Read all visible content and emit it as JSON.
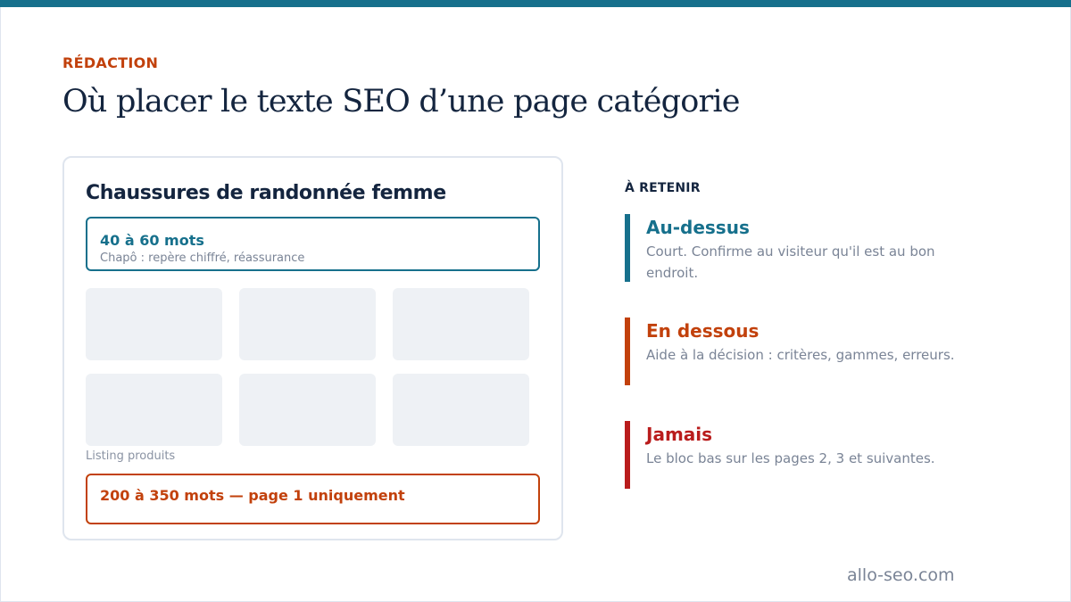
{
  "colors": {
    "accent_teal": "#16708c",
    "accent_orange": "#c2410c",
    "accent_red": "#b91c1c",
    "ink": "#14253f"
  },
  "kicker": "RÉDACTION",
  "title": "Où placer le texte SEO d’une page catégorie",
  "mockup": {
    "page_title": "Chaussures de randonnée femme",
    "top_block": {
      "label": "40 à 60 mots",
      "description": "Chapô : repère chiffré, réassurance"
    },
    "listing_label": "Listing produits",
    "bottom_block": {
      "label": "200 à 350 mots — page 1 uniquement"
    }
  },
  "retain": {
    "label": "À RETENIR",
    "points": [
      {
        "title": "Au-dessus",
        "color": "#16708c",
        "description": "Court. Confirme au visiteur qu'il est au bon endroit."
      },
      {
        "title": "En dessous",
        "color": "#c2410c",
        "description": "Aide à la décision : critères, gammes, erreurs."
      },
      {
        "title": "Jamais",
        "color": "#b91c1c",
        "description": "Le bloc bas sur les pages 2, 3 et suivantes."
      }
    ]
  },
  "footer": "allo-seo.com"
}
